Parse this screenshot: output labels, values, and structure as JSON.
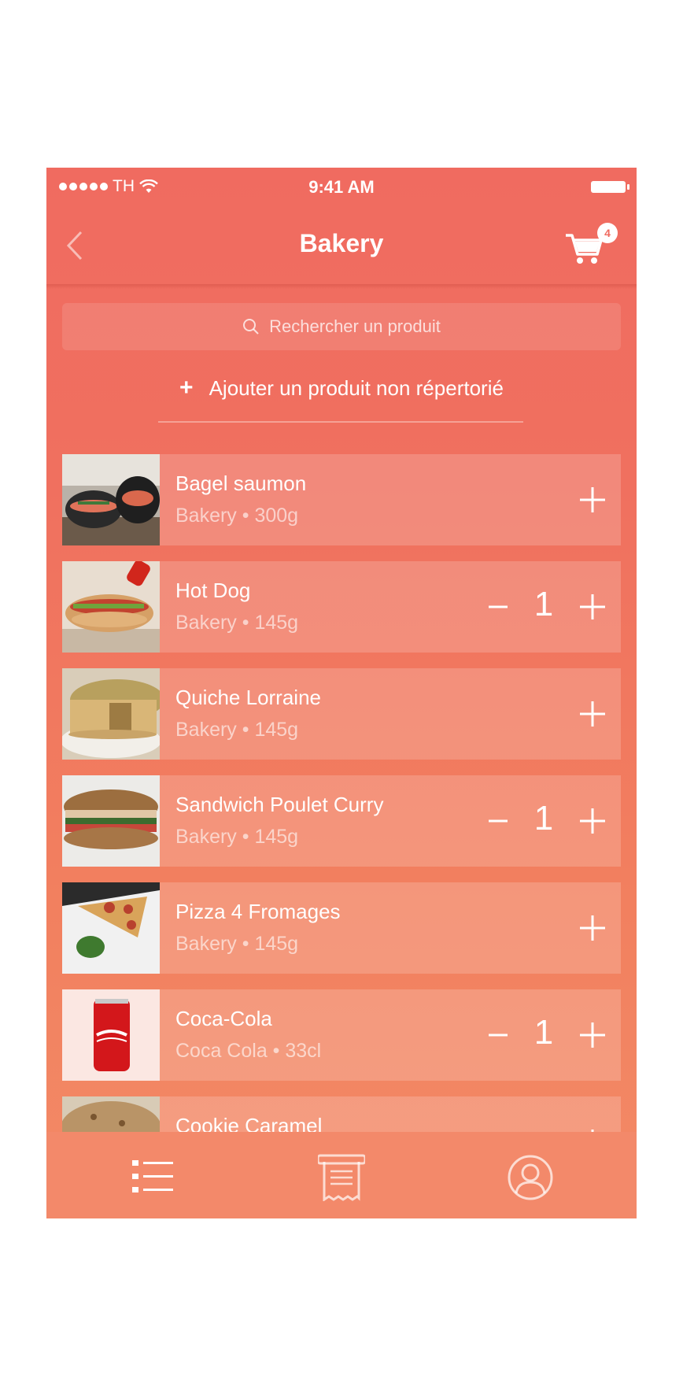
{
  "status": {
    "carrier": "TH",
    "time": "9:41 AM"
  },
  "nav": {
    "title": "Bakery",
    "cart_count": "4"
  },
  "search": {
    "placeholder": "Rechercher un produit"
  },
  "add_link": {
    "plus": "+",
    "label": "Ajouter un produit non répertorié"
  },
  "items": [
    {
      "name": "Bagel saumon",
      "meta": "Bakery • 300g",
      "qty": ""
    },
    {
      "name": "Hot Dog",
      "meta": "Bakery • 145g",
      "qty": "1"
    },
    {
      "name": "Quiche Lorraine",
      "meta": "Bakery • 145g",
      "qty": ""
    },
    {
      "name": "Sandwich Poulet Curry",
      "meta": "Bakery • 145g",
      "qty": "1"
    },
    {
      "name": "Pizza 4 Fromages",
      "meta": "Bakery • 145g",
      "qty": ""
    },
    {
      "name": "Coca-Cola",
      "meta": "Coca Cola • 33cl",
      "qty": "1"
    },
    {
      "name": "Cookie Caramel",
      "meta": "",
      "qty": ""
    }
  ],
  "tabs": [
    {
      "icon": "list-icon"
    },
    {
      "icon": "receipt-icon"
    },
    {
      "icon": "profile-icon"
    }
  ],
  "colors": {
    "background_top": "#f06b60",
    "background_bottom": "#f38a66",
    "tabbar": "#f3896a",
    "text": "#ffffff"
  }
}
